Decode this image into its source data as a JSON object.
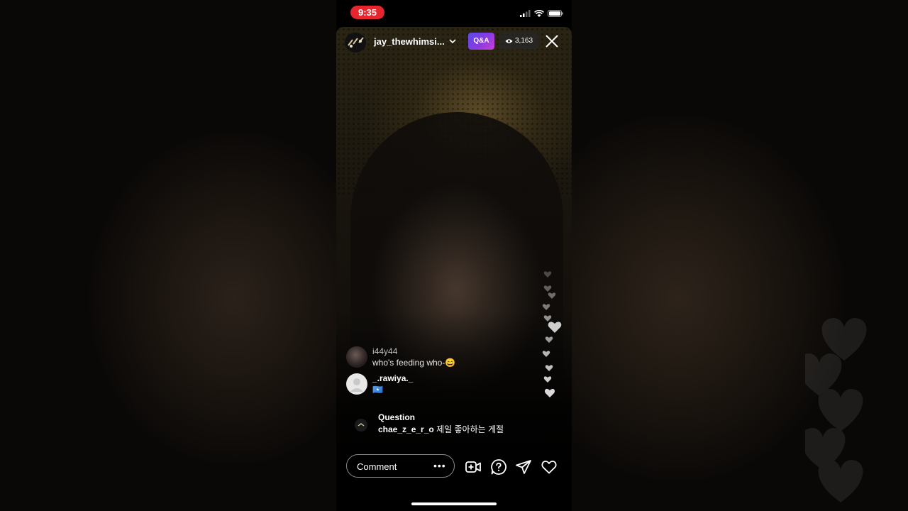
{
  "status_bar": {
    "time": "9:35"
  },
  "live": {
    "username": "jay_thewhimsi...",
    "badge": "Q&A",
    "viewer_count": "3,163"
  },
  "comments": [
    {
      "user": "i44y44",
      "text": "who's feeding who-😄"
    },
    {
      "user": "_.rawiya._",
      "text": "🇸🇴"
    }
  ],
  "question": {
    "title": "Question",
    "user": "chae_z_e_r_o",
    "text": "제일 좋아하는 게절"
  },
  "bottom_bar": {
    "comment_placeholder": "Comment",
    "more": "•••"
  },
  "colors": {
    "time_pill": "#e5262f",
    "qa_gradient_start": "#5b4be8",
    "qa_gradient_end": "#c93fd6"
  }
}
